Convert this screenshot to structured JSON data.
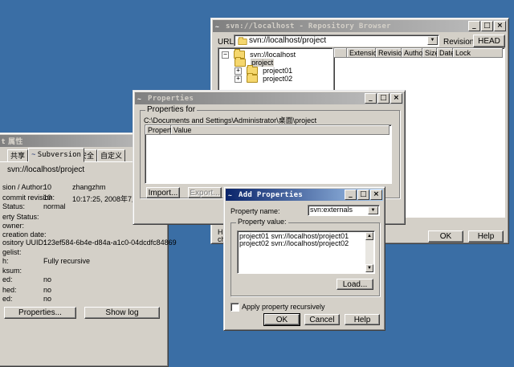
{
  "repo_browser": {
    "title": "svn://localhost - Repository Browser",
    "url_label": "URL:",
    "url_value": "svn://localhost/project",
    "revision_label": "Revision:",
    "head_button": "HEAD",
    "tree": [
      {
        "label": "svn://localhost"
      },
      {
        "label": "project"
      },
      {
        "label": "project01"
      },
      {
        "label": "project02"
      }
    ],
    "columns": [
      "Extension",
      "Revision",
      "Author",
      "Size",
      "Date",
      "Lock"
    ],
    "hint_fragment_1": "Hin",
    "hint_fragment_2": "chi",
    "ok_button": "OK",
    "help_button": "Help"
  },
  "left_props": {
    "title": "t 属性",
    "tabs": [
      "共享",
      "Subversion",
      "安全",
      "自定义"
    ],
    "url": "svn://localhost/project",
    "rows": [
      {
        "label": "sion / Author:",
        "v1": "10",
        "v2": "zhangzhm"
      },
      {
        "label": "commit revision:",
        "v1": "10",
        "v2": "10:17:25, 2008年7月11日"
      },
      {
        "label": "Status:",
        "v1": "normal",
        "v2": ""
      },
      {
        "label": "erty Status:",
        "v1": "",
        "v2": ""
      },
      {
        "label": "owner:",
        "v1": "",
        "v2": ""
      },
      {
        "label": "creation date:",
        "v1": "",
        "v2": ""
      },
      {
        "label": "ository UUID:",
        "v1": "123ef584-6b4e-d84a-a1c0-04dcdfc84869",
        "v2": ""
      },
      {
        "label": "gelist:",
        "v1": "",
        "v2": ""
      },
      {
        "label": "h:",
        "v1": "Fully recursive",
        "v2": ""
      },
      {
        "label": "ksum:",
        "v1": "",
        "v2": ""
      },
      {
        "label": "ed:",
        "v1": "no",
        "v2": ""
      },
      {
        "label": "hed:",
        "v1": "no",
        "v2": ""
      },
      {
        "label": "ed:",
        "v1": "no",
        "v2": ""
      }
    ],
    "properties_button": "Properties...",
    "showlog_button": "Show log"
  },
  "properties_dialog": {
    "title": "Properties",
    "group_label": "Properties for",
    "path": "C:\\Documents and Settings\\Administrator\\桌面\\project",
    "columns": [
      "Property",
      "Value"
    ],
    "import_button": "Import...",
    "export_button": "Export..."
  },
  "add_dialog": {
    "title": "Add Properties",
    "name_label": "Property name:",
    "name_value": "svn:externals",
    "value_label": "Property value:",
    "value_lines": [
      "project01 svn://localhost/project01",
      "project02 svn://localhost/project02"
    ],
    "load_button": "Load...",
    "recursive_label": "Apply property recursively",
    "ok_button": "OK",
    "cancel_button": "Cancel",
    "help_button": "Help"
  }
}
